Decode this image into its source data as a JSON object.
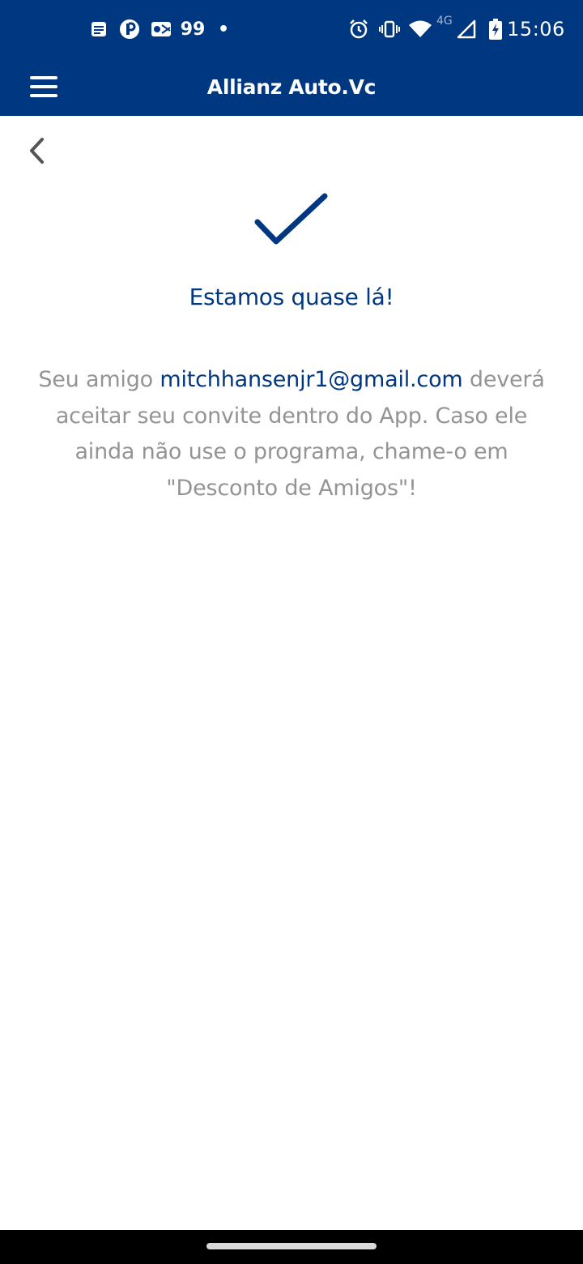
{
  "status_bar": {
    "notification_icons": [
      "news-icon",
      "parking-app-icon",
      "mail-app-icon"
    ],
    "app_badge": "99",
    "more_indicator": "•",
    "system_icons": [
      "alarm-icon",
      "vibrate-icon",
      "wifi-icon",
      "4g-signal-icon",
      "battery-charging-icon"
    ],
    "network_label": "4G",
    "time": "15:06"
  },
  "app_bar": {
    "title": "Allianz Auto.Vc",
    "menu_icon": "hamburger-menu-icon"
  },
  "content": {
    "back_icon": "chevron-left-icon",
    "status_icon": "checkmark-icon",
    "headline": "Estamos quase lá!",
    "message_prefix": "Seu amigo ",
    "friend_email": "mitchhansenjr1@gmail.com",
    "message_suffix": " deverá aceitar seu convite dentro do App. Caso ele ainda não use o programa, chame-o em \"Desconto de Amigos\"!"
  },
  "colors": {
    "brand_blue": "#003781",
    "body_text_gray": "#949494",
    "background": "#ffffff"
  }
}
